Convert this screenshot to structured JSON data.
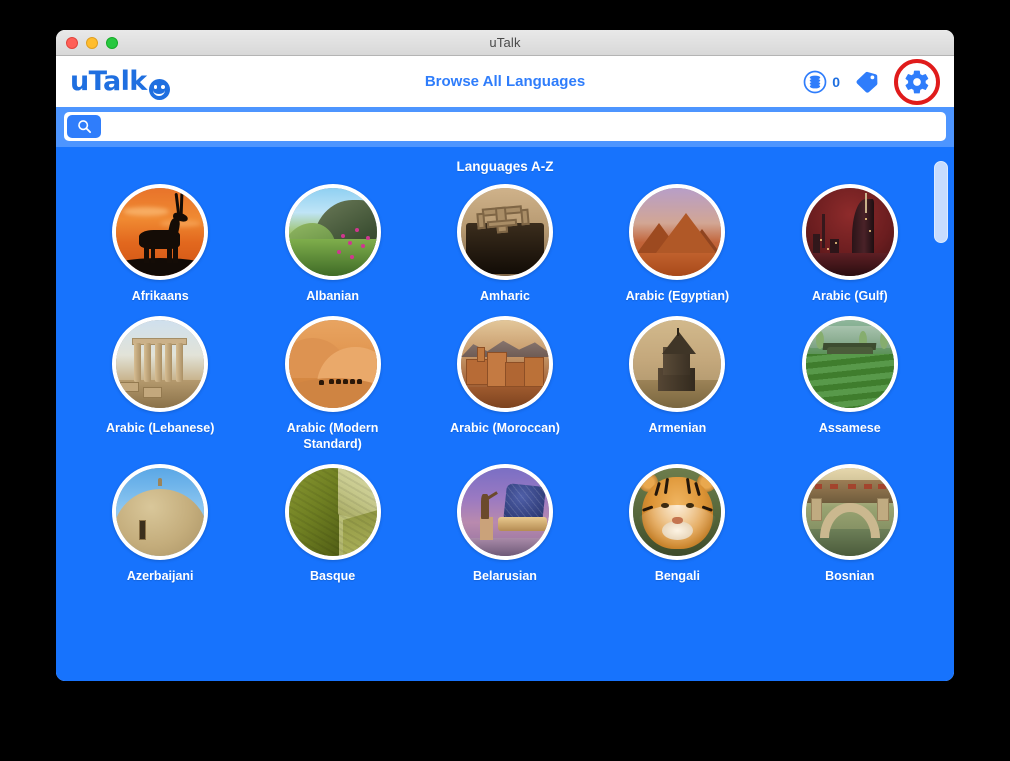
{
  "window": {
    "title": "uTalk",
    "controls": {
      "close": "close",
      "minimize": "minimize",
      "maximize": "maximize"
    }
  },
  "header": {
    "brand": "uTalk",
    "title": "Browse All Languages",
    "credits_count": "0",
    "credits_icon": "coins-icon",
    "tag_icon": "tag-icon",
    "settings_icon": "gear-icon"
  },
  "search": {
    "placeholder": "",
    "value": "",
    "button_icon": "search-icon"
  },
  "content": {
    "section_title": "Languages A-Z",
    "languages": [
      {
        "name": "Afrikaans",
        "art": "art-afrikaans"
      },
      {
        "name": "Albanian",
        "art": "art-albanian"
      },
      {
        "name": "Amharic",
        "art": "art-amharic"
      },
      {
        "name": "Arabic (Egyptian)",
        "art": "art-egy"
      },
      {
        "name": "Arabic (Gulf)",
        "art": "art-gulf"
      },
      {
        "name": "Arabic (Lebanese)",
        "art": "art-leb"
      },
      {
        "name": "Arabic (Modern Standard)",
        "art": "art-msa"
      },
      {
        "name": "Arabic (Moroccan)",
        "art": "art-mor"
      },
      {
        "name": "Armenian",
        "art": "art-arm"
      },
      {
        "name": "Assamese",
        "art": "art-ass"
      },
      {
        "name": "Azerbaijani",
        "art": "art-aze"
      },
      {
        "name": "Basque",
        "art": "art-bas"
      },
      {
        "name": "Belarusian",
        "art": "art-bel"
      },
      {
        "name": "Bengali",
        "art": "art-ben"
      },
      {
        "name": "Bosnian",
        "art": "art-bos"
      }
    ]
  },
  "colors": {
    "content_blue": "#1773fd",
    "strip_blue": "#4d95ff",
    "accent_blue": "#2f7dfb",
    "brand_blue": "#1f6fe0",
    "highlight_red": "#e01b1b",
    "scrollbar_thumb": "#c7dcfe"
  }
}
